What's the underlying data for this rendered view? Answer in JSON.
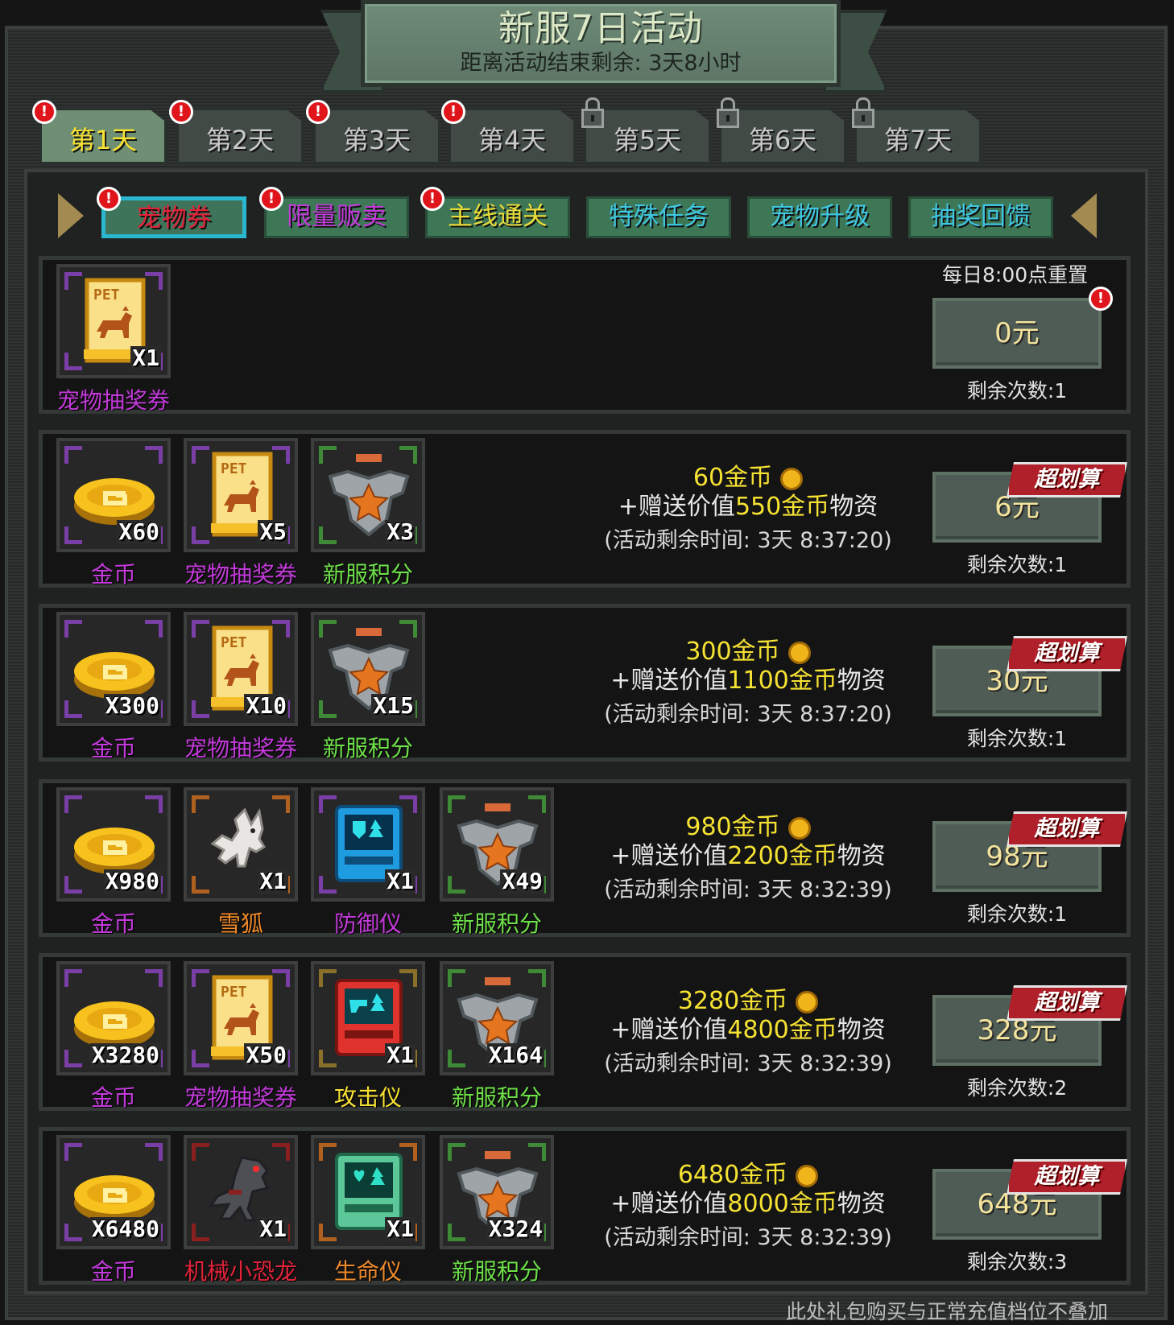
{
  "header": {
    "title": "新服7日活动",
    "subtitle": "距离活动结束剩余: 3天8小时"
  },
  "day_tabs": [
    {
      "label": "第1天",
      "state": "active",
      "badge": "!"
    },
    {
      "label": "第2天",
      "state": "normal",
      "badge": "!"
    },
    {
      "label": "第3天",
      "state": "normal",
      "badge": "!"
    },
    {
      "label": "第4天",
      "state": "normal",
      "badge": "!"
    },
    {
      "label": "第5天",
      "state": "locked",
      "badge": ""
    },
    {
      "label": "第6天",
      "state": "locked",
      "badge": ""
    },
    {
      "label": "第7天",
      "state": "locked",
      "badge": ""
    }
  ],
  "category_tabs": [
    {
      "label": "宠物券",
      "color": "#e2233a",
      "active": true,
      "badge": "!"
    },
    {
      "label": "限量贩卖",
      "color": "#c23ad9",
      "active": false,
      "badge": "!"
    },
    {
      "label": "主线通关",
      "color": "#e8dc3a",
      "active": false,
      "badge": "!"
    },
    {
      "label": "特殊任务",
      "color": "#3fc6e0",
      "active": false,
      "badge": ""
    },
    {
      "label": "宠物升级",
      "color": "#3fc6e0",
      "active": false,
      "badge": ""
    },
    {
      "label": "抽奖回馈",
      "color": "#3fc6e0",
      "active": false,
      "badge": ""
    }
  ],
  "packs": [
    {
      "items": [
        {
          "name": "宠物抽奖券",
          "count": "X1",
          "icon": "pet-ticket-icon",
          "name_color": "#c23ad9",
          "frame": "#7a3fa7"
        }
      ],
      "desc": null,
      "reset_label": "每日8:00点重置",
      "price": "0元",
      "remaining": "剩余次数:1",
      "ribbon": "",
      "badge": "!"
    },
    {
      "items": [
        {
          "name": "金币",
          "count": "X60",
          "icon": "gold-coin-icon",
          "name_color": "#c23ad9",
          "frame": "#7a3fa7"
        },
        {
          "name": "宠物抽奖券",
          "count": "X5",
          "icon": "pet-ticket-icon",
          "name_color": "#c23ad9",
          "frame": "#7a3fa7"
        },
        {
          "name": "新服积分",
          "count": "X3",
          "icon": "eagle-badge-icon",
          "name_color": "#6ee04a",
          "frame": "#3f8a36"
        }
      ],
      "desc": {
        "coins": "60金币",
        "bonus_prefix": "+赠送价值",
        "bonus_value": "550金币",
        "bonus_suffix": "物资",
        "timer": "(活动剩余时间: 3天 8:37:20)"
      },
      "price": "6元",
      "remaining": "剩余次数:1",
      "ribbon": "超划算"
    },
    {
      "items": [
        {
          "name": "金币",
          "count": "X300",
          "icon": "gold-coin-icon",
          "name_color": "#c23ad9",
          "frame": "#7a3fa7"
        },
        {
          "name": "宠物抽奖券",
          "count": "X10",
          "icon": "pet-ticket-icon",
          "name_color": "#c23ad9",
          "frame": "#7a3fa7"
        },
        {
          "name": "新服积分",
          "count": "X15",
          "icon": "eagle-badge-icon",
          "name_color": "#6ee04a",
          "frame": "#3f8a36"
        }
      ],
      "desc": {
        "coins": "300金币",
        "bonus_prefix": "+赠送价值",
        "bonus_value": "1100金币",
        "bonus_suffix": "物资",
        "timer": "(活动剩余时间: 3天 8:37:20)"
      },
      "price": "30元",
      "remaining": "剩余次数:1",
      "ribbon": "超划算"
    },
    {
      "items": [
        {
          "name": "金币",
          "count": "X980",
          "icon": "gold-coin-icon",
          "name_color": "#c23ad9",
          "frame": "#7a3fa7"
        },
        {
          "name": "雪狐",
          "count": "X1",
          "icon": "snow-fox-icon",
          "name_color": "#f08a2a",
          "frame": "#b0601f"
        },
        {
          "name": "防御仪",
          "count": "X1",
          "icon": "defense-device-icon",
          "name_color": "#c23ad9",
          "frame": "#7a3fa7"
        },
        {
          "name": "新服积分",
          "count": "X49",
          "icon": "eagle-badge-icon",
          "name_color": "#6ee04a",
          "frame": "#3f8a36"
        }
      ],
      "desc": {
        "coins": "980金币",
        "bonus_prefix": "+赠送价值",
        "bonus_value": "2200金币",
        "bonus_suffix": "物资",
        "timer": "(活动剩余时间: 3天 8:32:39)"
      },
      "price": "98元",
      "remaining": "剩余次数:1",
      "ribbon": "超划算"
    },
    {
      "items": [
        {
          "name": "金币",
          "count": "X3280",
          "icon": "gold-coin-icon",
          "name_color": "#c23ad9",
          "frame": "#7a3fa7"
        },
        {
          "name": "宠物抽奖券",
          "count": "X50",
          "icon": "pet-ticket-icon",
          "name_color": "#c23ad9",
          "frame": "#7a3fa7"
        },
        {
          "name": "攻击仪",
          "count": "X1",
          "icon": "attack-device-icon",
          "name_color": "#f6e233",
          "frame": "#8a6f2a"
        },
        {
          "name": "新服积分",
          "count": "X164",
          "icon": "eagle-badge-icon",
          "name_color": "#6ee04a",
          "frame": "#3f8a36"
        }
      ],
      "desc": {
        "coins": "3280金币",
        "bonus_prefix": "+赠送价值",
        "bonus_value": "4800金币",
        "bonus_suffix": "物资",
        "timer": "(活动剩余时间: 3天 8:32:39)"
      },
      "price": "328元",
      "remaining": "剩余次数:2",
      "ribbon": "超划算"
    },
    {
      "items": [
        {
          "name": "金币",
          "count": "X6480",
          "icon": "gold-coin-icon",
          "name_color": "#c23ad9",
          "frame": "#7a3fa7"
        },
        {
          "name": "机械小恐龙",
          "count": "X1",
          "icon": "mech-dino-icon",
          "name_color": "#e2233a",
          "frame": "#8a1f1f"
        },
        {
          "name": "生命仪",
          "count": "X1",
          "icon": "life-device-icon",
          "name_color": "#f08a2a",
          "frame": "#b0601f"
        },
        {
          "name": "新服积分",
          "count": "X324",
          "icon": "eagle-badge-icon",
          "name_color": "#6ee04a",
          "frame": "#3f8a36"
        }
      ],
      "desc": {
        "coins": "6480金币",
        "bonus_prefix": "+赠送价值",
        "bonus_value": "8000金币",
        "bonus_suffix": "物资",
        "timer": "(活动剩余时间: 3天 8:32:39)"
      },
      "price": "648元",
      "remaining": "剩余次数:3",
      "ribbon": "超划算"
    }
  ],
  "footer_note": "此处礼包购买与正常充值档位不叠加"
}
